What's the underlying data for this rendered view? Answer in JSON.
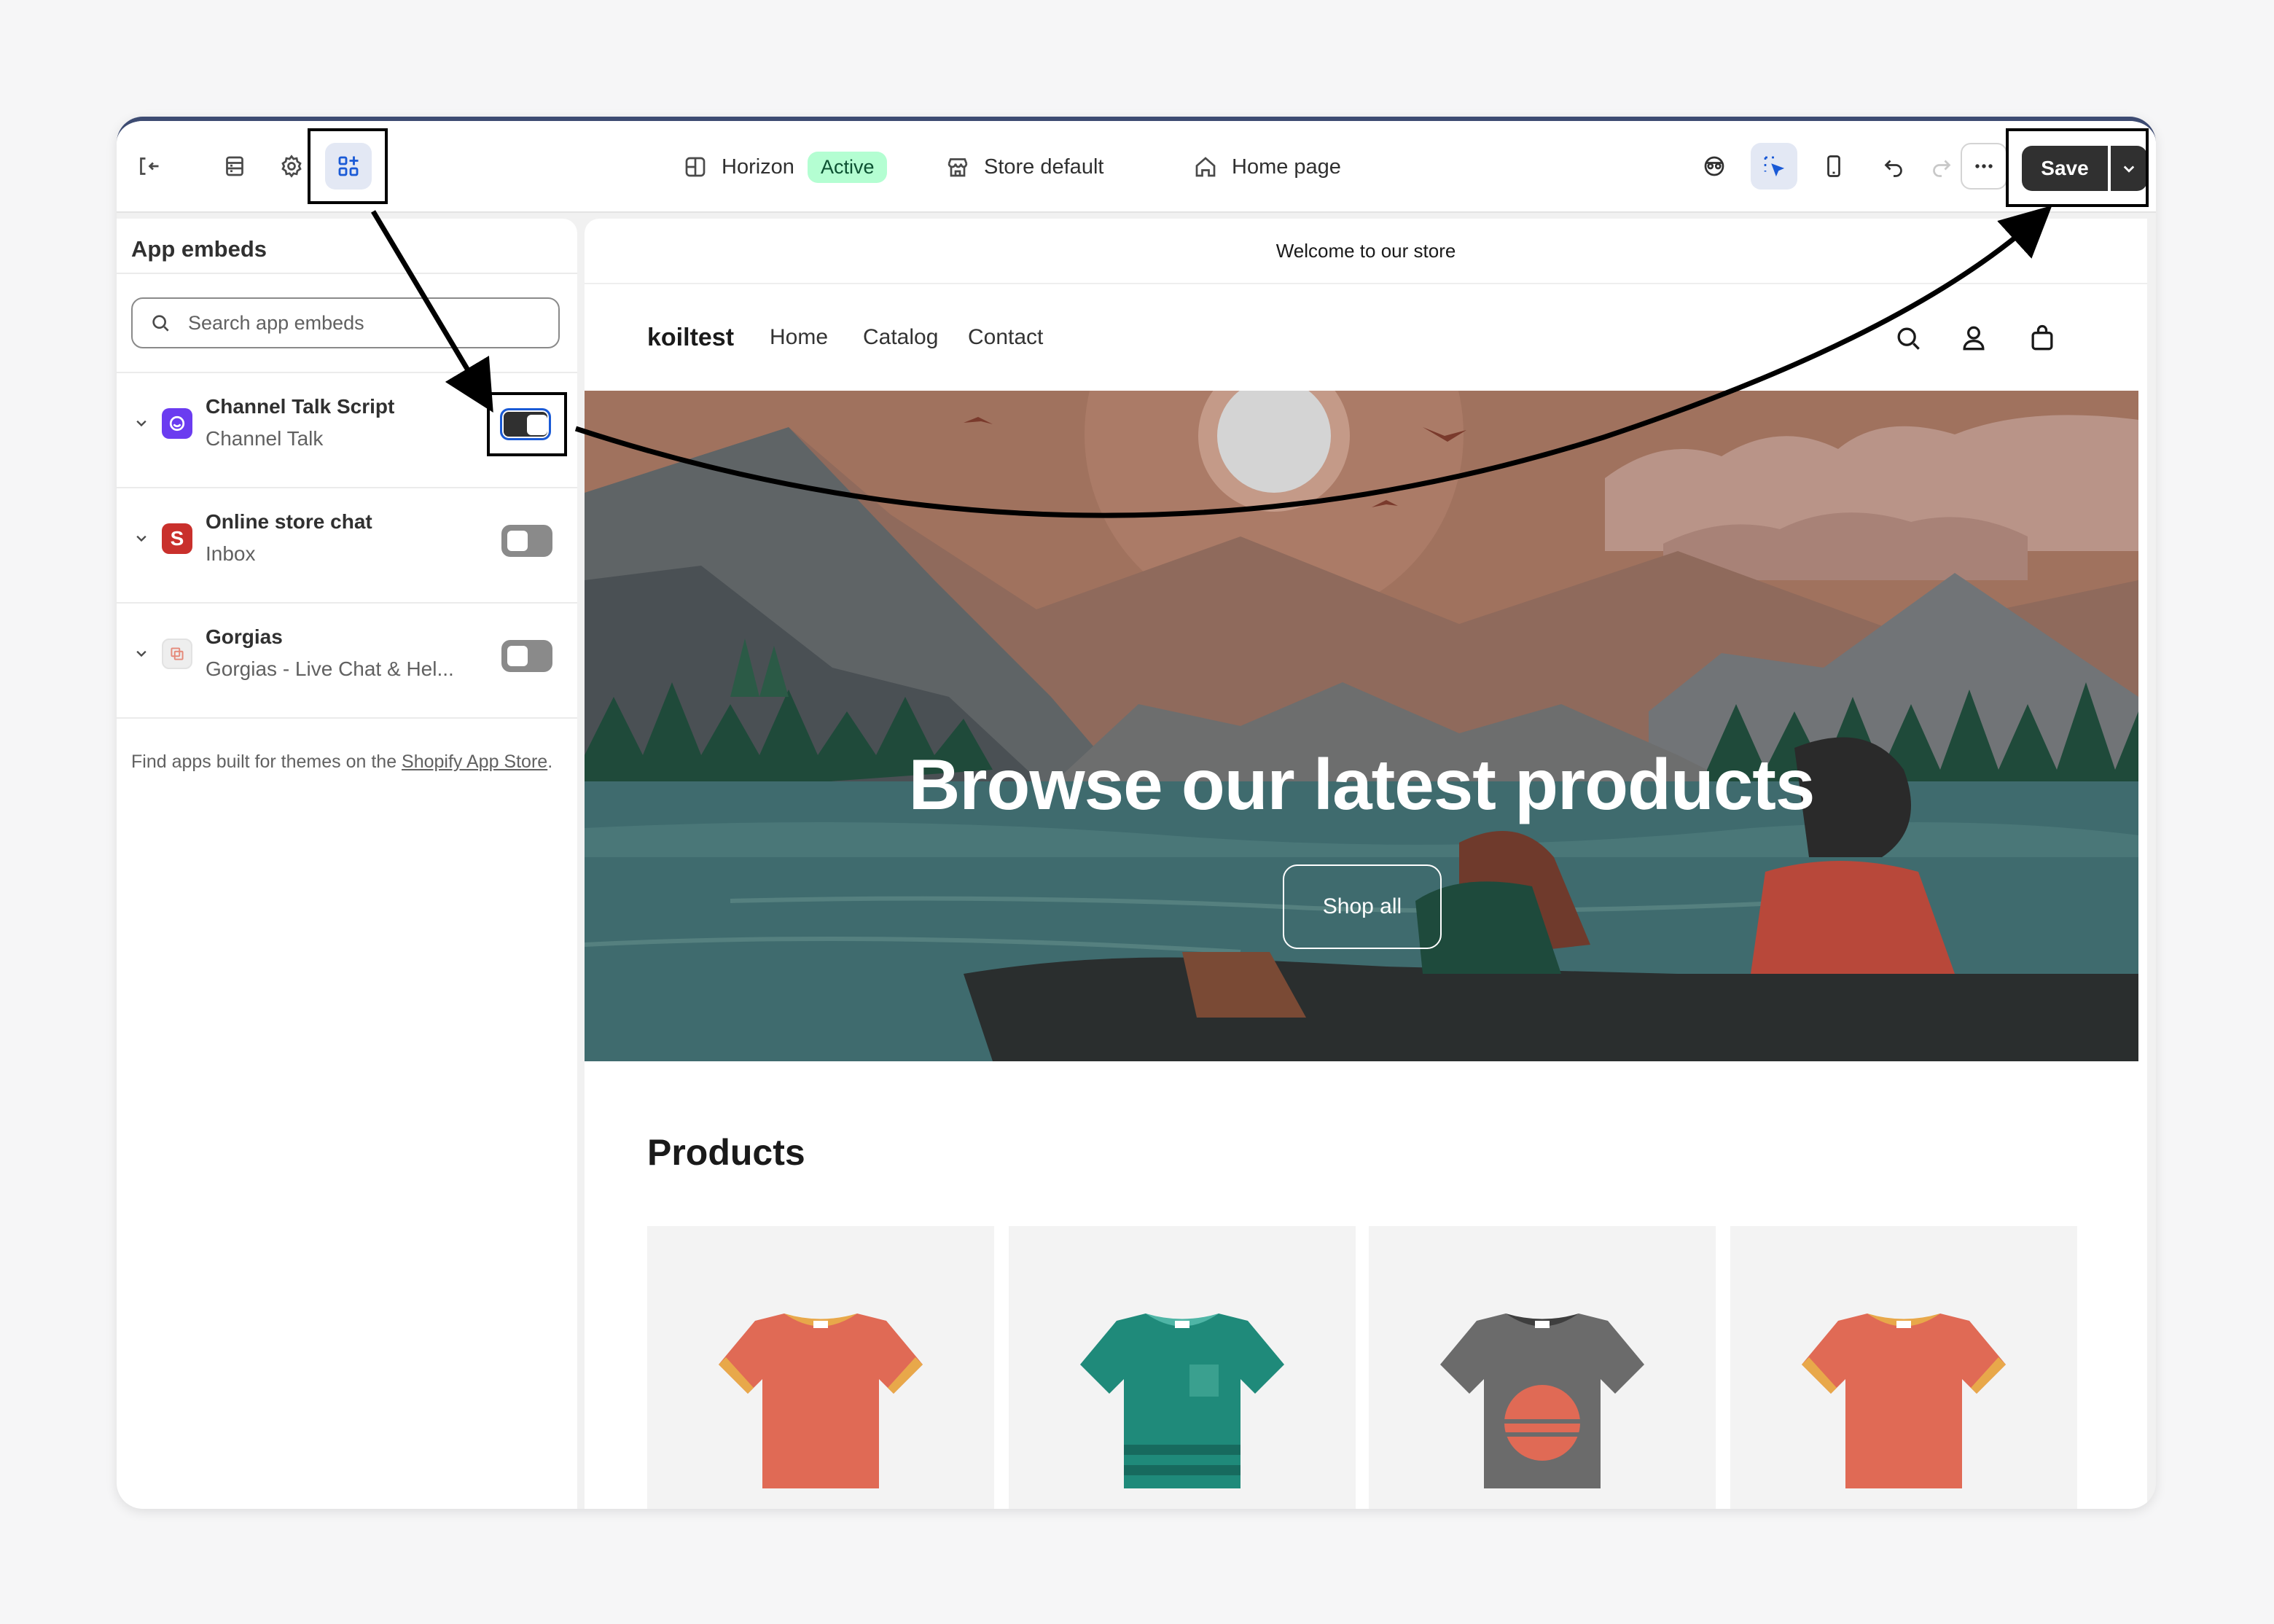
{
  "topbar": {
    "theme_name": "Horizon",
    "theme_status": "Active",
    "store_setting": "Store default",
    "page_select": "Home page",
    "save_label": "Save",
    "icons": [
      "exit-icon",
      "sections-icon",
      "settings-icon",
      "app-embeds-icon",
      "inspector-icon",
      "selector-icon",
      "mobile-preview-icon",
      "undo-icon",
      "redo-icon",
      "more-icon",
      "chevron-down-icon"
    ]
  },
  "sidebar": {
    "title": "App embeds",
    "search_placeholder": "Search app embeds",
    "embeds": [
      {
        "name": "Channel Talk Script",
        "provider": "Channel Talk",
        "enabled": true,
        "icon": "channel-talk-icon"
      },
      {
        "name": "Online store chat",
        "provider": "Inbox",
        "enabled": false,
        "icon": "inbox-icon"
      },
      {
        "name": "Gorgias",
        "provider": "Gorgias - Live Chat & Hel...",
        "enabled": false,
        "icon": "gorgias-icon"
      }
    ],
    "footer_text": "Find apps built for themes on the ",
    "footer_link": "Shopify App Store",
    "footer_end": "."
  },
  "preview": {
    "announcement": "Welcome to our store",
    "store_name": "koiltest",
    "nav": [
      "Home",
      "Catalog",
      "Contact"
    ],
    "hero_title": "Browse our latest products",
    "hero_button": "Shop all",
    "products_heading": "Products",
    "product_colors": [
      "#e06a55",
      "#1f8a7a",
      "#6b6b6b",
      "#e06a55"
    ]
  },
  "colors": {
    "accent": "#303030",
    "active_badge_bg": "#b4fed2",
    "active_badge_text": "#0c5132",
    "toggle_focus": "#1a5ad6"
  }
}
